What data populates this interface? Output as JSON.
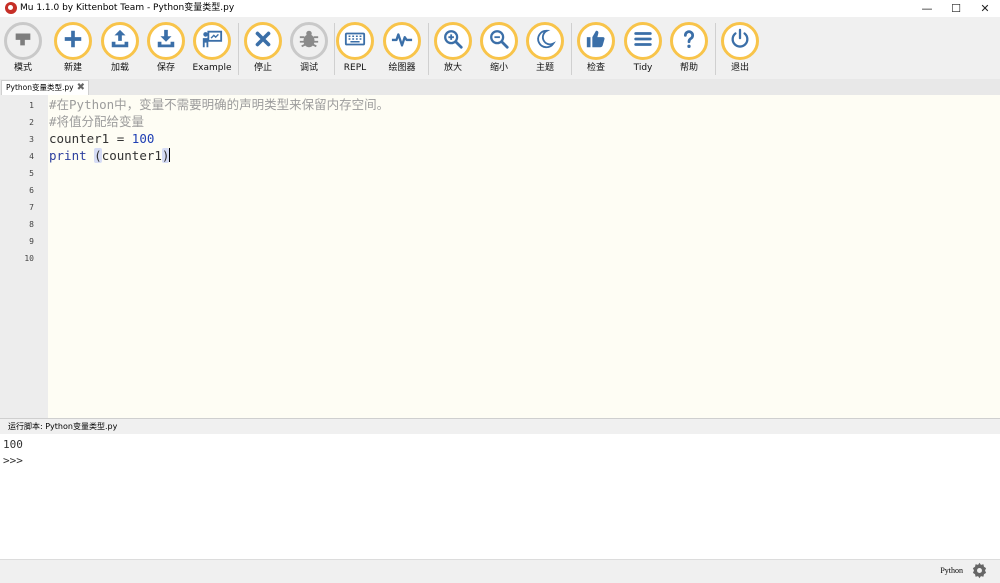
{
  "window": {
    "title": "Mu 1.1.0 by Kittenbot Team - Python变量类型.py",
    "minimize_glyph": "—",
    "maximize_glyph": "☐",
    "close_glyph": "✕"
  },
  "toolbar": {
    "buttons": [
      {
        "label": "模式",
        "icon": "mode-icon"
      },
      {
        "label": "新建",
        "icon": "plus-icon"
      },
      {
        "label": "加载",
        "icon": "upload-icon"
      },
      {
        "label": "保存",
        "icon": "download-icon"
      },
      {
        "label": "Example",
        "icon": "presentation-icon"
      },
      {
        "label": "停止",
        "icon": "close-icon"
      },
      {
        "label": "调试",
        "icon": "bug-icon"
      },
      {
        "label": "REPL",
        "icon": "keyboard-icon"
      },
      {
        "label": "绘图器",
        "icon": "pulse-icon"
      },
      {
        "label": "放大",
        "icon": "zoom-in-icon"
      },
      {
        "label": "缩小",
        "icon": "zoom-out-icon"
      },
      {
        "label": "主题",
        "icon": "moon-icon"
      },
      {
        "label": "检查",
        "icon": "thumbs-up-icon"
      },
      {
        "label": "Tidy",
        "icon": "lines-icon"
      },
      {
        "label": "帮助",
        "icon": "help-icon"
      },
      {
        "label": "退出",
        "icon": "power-icon"
      }
    ],
    "accent_color": "#f8c44a",
    "icon_color": "#3b6fa8"
  },
  "tabs": [
    {
      "label": "Python变量类型.py",
      "close_glyph": "✖"
    }
  ],
  "editor": {
    "line_numbers": [
      "1",
      "2",
      "3",
      "4",
      "5",
      "6",
      "7",
      "8",
      "9",
      "10"
    ],
    "lines": {
      "comment1": "#在Python中，变量不需要明确的声明类型来保留内存空间。",
      "comment2": "#将值分配给变量",
      "assign_name": "counter1",
      "assign_op": " = ",
      "assign_value": "100",
      "print_kw": "print",
      "print_space": " ",
      "print_open": "(",
      "print_arg": "counter1",
      "print_close": ")"
    },
    "background_color": "#fefdf4"
  },
  "repl": {
    "header": "运行脚本: Python变量类型.py",
    "output": [
      "100",
      ">>>"
    ]
  },
  "statusbar": {
    "mode": "Python",
    "settings_icon": "gear-icon"
  }
}
